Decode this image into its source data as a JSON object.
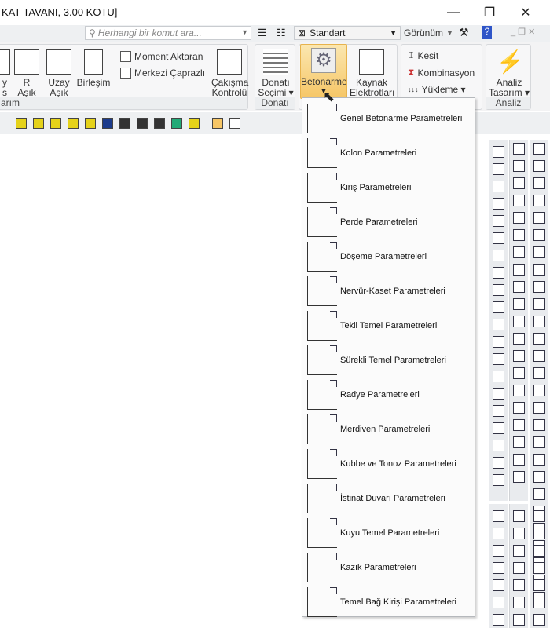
{
  "window": {
    "title": "KAT TAVANI,  3.00 KOTU]",
    "minimize": "—",
    "restore": "❐",
    "close": "✕"
  },
  "quickbar": {
    "search_placeholder": "Herhangi bir komut ara...",
    "style_value": "Standart",
    "view_label": "Görünüm",
    "help": "?"
  },
  "ribbon": {
    "group1": {
      "label": "arım",
      "items": [
        "y\ns",
        "R\nAşık",
        "Uzay\nAşık",
        "Birleşim"
      ],
      "moment": "Moment Aktaran",
      "merkezi": "Merkezi Çaprazlı",
      "cakisma": "Çakışma\nKontrolü"
    },
    "donati": {
      "label": "Donatı",
      "item": "Donatı\nSeçimi ▾"
    },
    "betonarme": {
      "betonarme": "Betonarme",
      "kaynak": "Kaynak\nElektrotları"
    },
    "kesit": {
      "kesit": "Kesit",
      "kombinasyon": "Kombinasyon",
      "yukleme": "Yükleme ▾"
    },
    "analiz": {
      "label": "Analiz",
      "item": "Analiz\nTasarım ▾"
    }
  },
  "menu": {
    "items": [
      "Genel Betonarme Parametreleri",
      "Kolon Parametreleri",
      "Kiriş Parametreleri",
      "Perde Parametreleri",
      "Döşeme Parametreleri",
      "Nervür-Kaset Parametreleri",
      "Tekil Temel Parametreleri",
      "Sürekli Temel Parametreleri",
      "Radye Parametreleri",
      "Merdiven Parametreleri",
      "Kubbe ve Tonoz Parametreleri",
      "İstinat Duvarı Parametreleri",
      "Kuyu Temel Parametreleri",
      "Kazık Parametreleri",
      "Temel Bağ Kirişi Parametreleri"
    ]
  },
  "colors": {
    "accent": "#f6c666",
    "icon_blue": "#1c3b8c",
    "warning_yellow": "#e5d21a"
  }
}
